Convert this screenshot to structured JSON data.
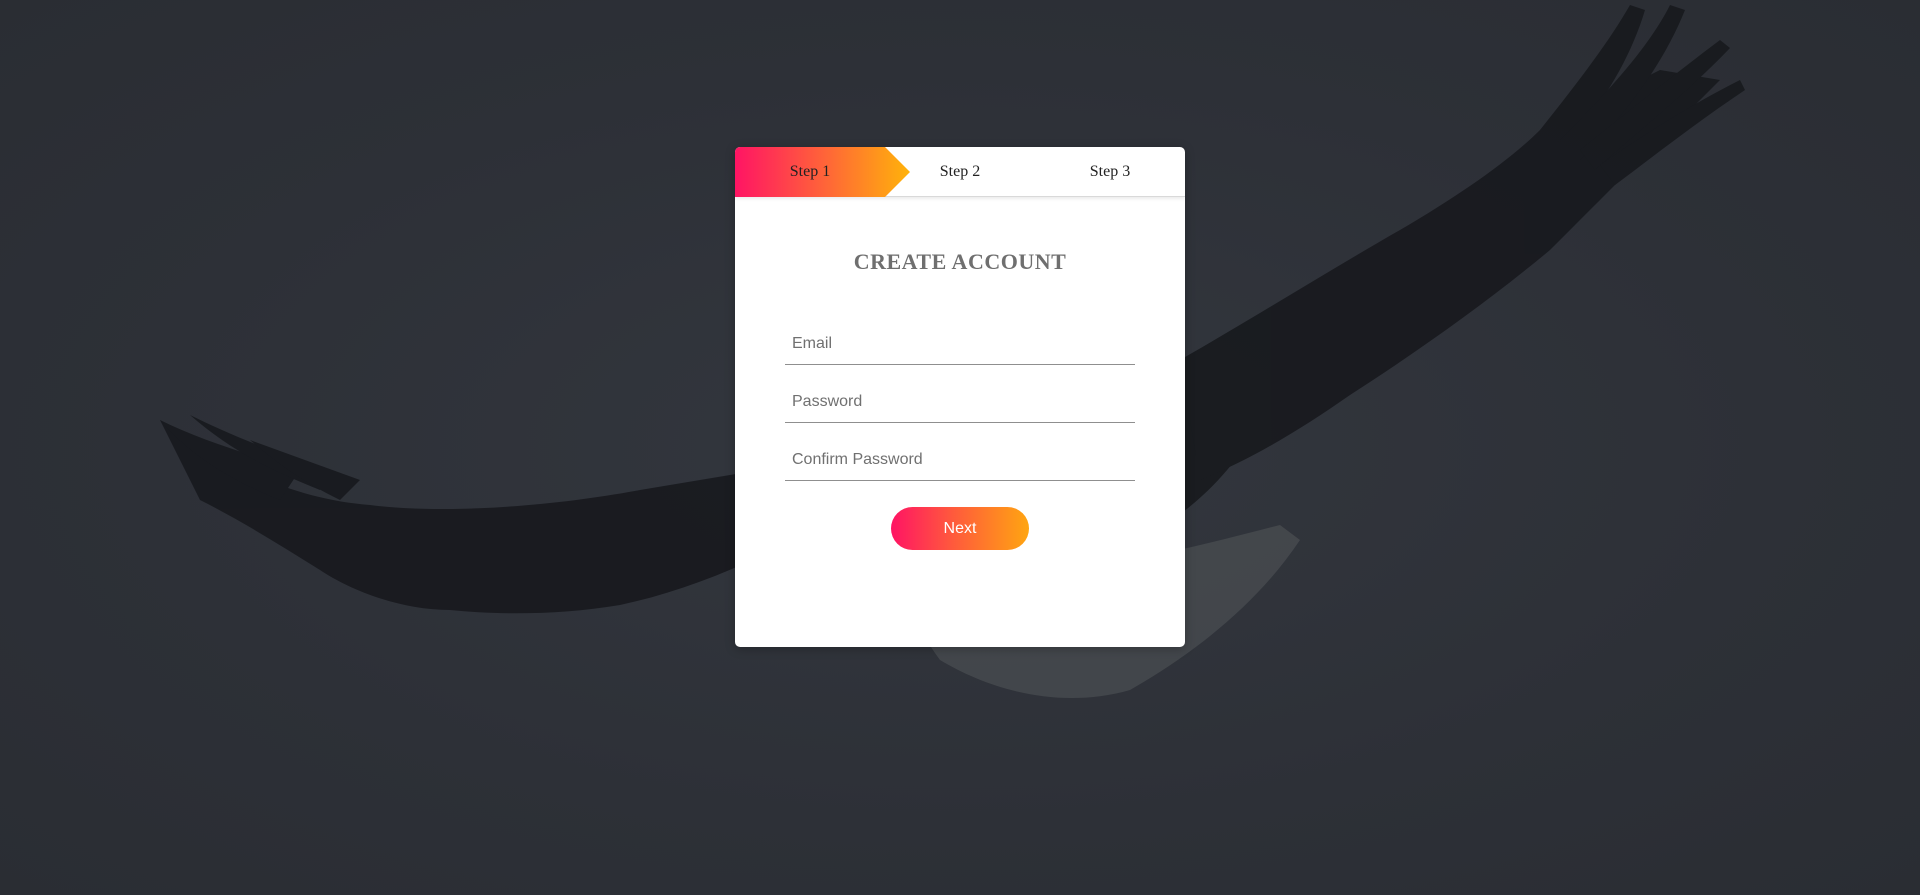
{
  "steps": [
    {
      "label": "Step 1",
      "active": true
    },
    {
      "label": "Step 2",
      "active": false
    },
    {
      "label": "Step 3",
      "active": false
    }
  ],
  "form": {
    "title": "CREATE ACCOUNT",
    "email_placeholder": "Email",
    "password_placeholder": "Password",
    "confirm_password_placeholder": "Confirm Password",
    "next_label": "Next"
  },
  "colors": {
    "gradient_start": "#ff1464",
    "gradient_end": "#ffa511",
    "background": "#2e3138"
  },
  "background_image": "eagle-silhouette"
}
